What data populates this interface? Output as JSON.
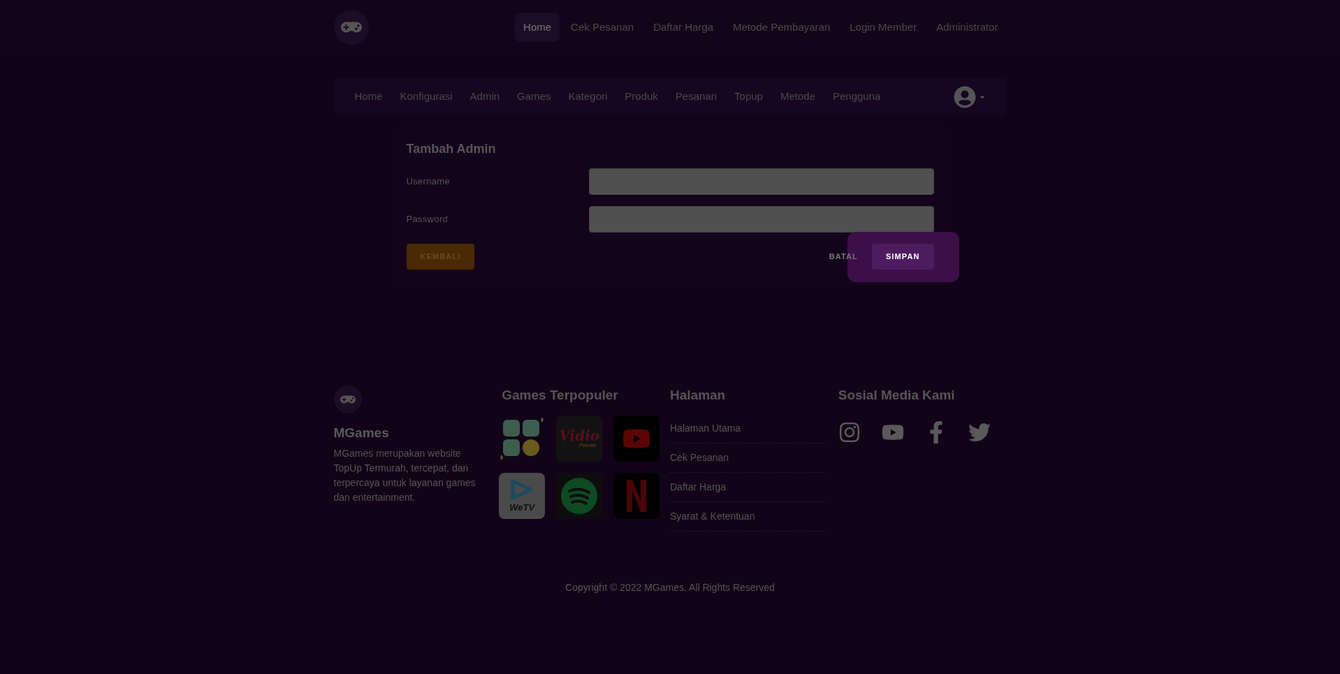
{
  "top_nav": {
    "items": [
      {
        "label": "Home",
        "selected": true
      },
      {
        "label": "Cek Pesanan",
        "selected": false
      },
      {
        "label": "Daftar Harga",
        "selected": false
      },
      {
        "label": "Metode Pembayaran",
        "selected": false
      },
      {
        "label": "Login Member",
        "selected": false
      },
      {
        "label": "Administrator",
        "selected": false
      }
    ]
  },
  "admin_nav": {
    "items": [
      "Home",
      "Konfigurasi",
      "Admin",
      "Games",
      "Kategori",
      "Produk",
      "Pesanan",
      "Topup",
      "Metode",
      "Pengguna"
    ]
  },
  "form": {
    "title": "Tambah Admin",
    "fields": [
      {
        "label": "Username"
      },
      {
        "label": "Password"
      }
    ],
    "back_button": "KEMBALI",
    "cancel_button": "BATAL",
    "save_button": "SIMPAN",
    "save_highlighted": true
  },
  "footer": {
    "brand": "MGames",
    "description": "MGames merupakan website TopUp Termurah, tercepat, dan terpercaya untuk layanan games dan entertainment.",
    "games_title": "Games Terpopuler",
    "games": [
      {
        "kind": "wallet"
      },
      {
        "kind": "vidio",
        "label": "Vidio",
        "sublabel": "Premier"
      },
      {
        "kind": "youtube"
      },
      {
        "kind": "wetv",
        "label": "WeTV"
      },
      {
        "kind": "spotify"
      },
      {
        "kind": "netflix"
      }
    ],
    "pages_title": "Halaman",
    "pages": [
      "Halaman Utama",
      "Cek Pesanan",
      "Daftar Harga",
      "Syarat & Ketentuan"
    ],
    "social_title": "Sosial Media Kami",
    "social": [
      {
        "kind": "instagram"
      },
      {
        "kind": "youtube"
      },
      {
        "kind": "facebook"
      },
      {
        "kind": "twitter"
      }
    ],
    "copyright": "Copyright © 2022 MGames. All Rights Reserved"
  }
}
